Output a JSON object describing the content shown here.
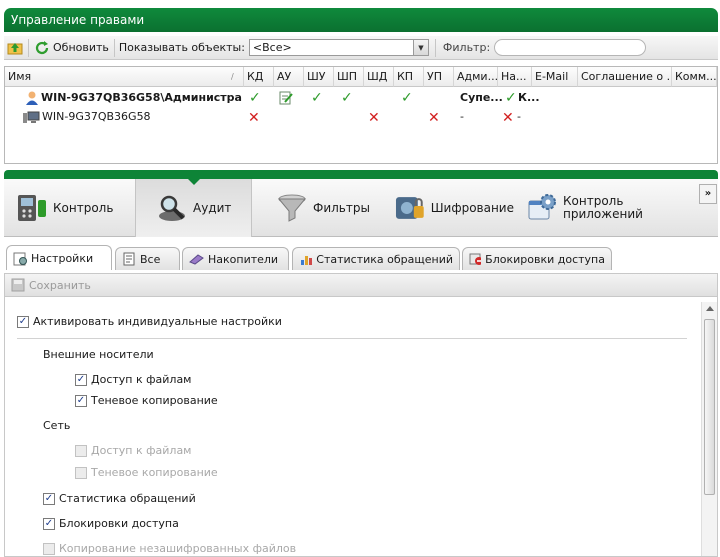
{
  "title": "Управление правами",
  "toolbar": {
    "refresh": "Обновить",
    "show_objects": "Показывать объекты:",
    "objects_value": "<Все>",
    "filter": "Фильтр:"
  },
  "grid": {
    "headers": [
      "Имя",
      "КД",
      "АУ",
      "ШУ",
      "ШП",
      "ШД",
      "КП",
      "УП",
      "Адми...",
      "На...",
      "E-Mail",
      "Соглашение о ...",
      "Комм..."
    ],
    "row1": {
      "name": "WIN-9G37QB36G58\\Администра...",
      "adm": "Супе...",
      "na": "К..."
    },
    "row2": {
      "name": "WIN-9G37QB36G58",
      "adm": "-",
      "na": "-"
    }
  },
  "main_tabs": [
    "Контроль",
    "Аудит",
    "Фильтры",
    "Шифрование",
    "Контроль приложений"
  ],
  "more": "»",
  "sub_tabs": [
    "Настройки",
    "Все",
    "Накопители",
    "Статистика обращений",
    "Блокировки доступа"
  ],
  "save": "Сохранить",
  "settings": {
    "activate": "Активировать индивидуальные настройки",
    "external": "Внешние носители",
    "file_access": "Доступ к файлам",
    "shadow": "Теневое копирование",
    "network": "Сеть",
    "net_file_access": "Доступ к файлам",
    "net_shadow": "Теневое копирование",
    "stats": "Статистика обращений",
    "blocks": "Блокировки доступа",
    "unencrypted": "Копирование незашифрованных файлов"
  }
}
